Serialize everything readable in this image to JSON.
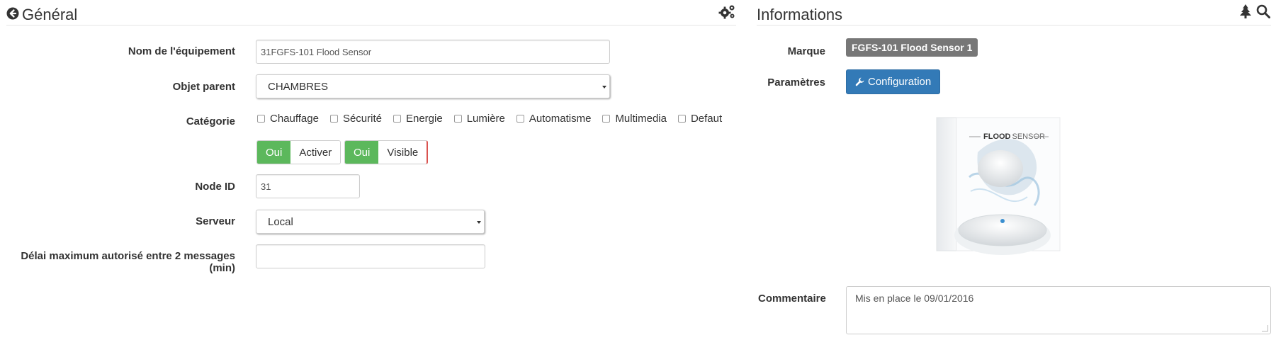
{
  "general_panel": {
    "title": "Général",
    "fields": {
      "name_label": "Nom de l'équipement",
      "name_value": "31FGFS-101 Flood Sensor",
      "parent_label": "Objet parent",
      "parent_value": "CHAMBRES",
      "category_label": "Catégorie",
      "categories": [
        "Chauffage",
        "Sécurité",
        "Energie",
        "Lumière",
        "Automatisme",
        "Multimedia",
        "Defaut"
      ],
      "toggle_activer": {
        "on_label": "Oui",
        "off_label": "Activer"
      },
      "toggle_visible": {
        "on_label": "Oui",
        "off_label": "Visible"
      },
      "node_label": "Node ID",
      "node_value": "31",
      "server_label": "Serveur",
      "server_value": "Local",
      "delay_label": "Délai maximum autorisé entre 2 messages (min)",
      "delay_value": ""
    }
  },
  "info_panel": {
    "title": "Informations",
    "brand_label": "Marque",
    "brand_value": "FGFS-101 Flood Sensor 1",
    "params_label": "Paramètres",
    "config_button": "Configuration",
    "comment_label": "Commentaire",
    "comment_value": "Mis en place le 09/01/2016",
    "product_image": {
      "brand_text": "FLOOD",
      "model_text": "SENSOR"
    }
  },
  "icons": {
    "back": "arrow-circle-left-icon",
    "gears": "cogs-icon",
    "tree": "tree-icon",
    "search": "search-icon",
    "wrench": "wrench-icon"
  },
  "colors": {
    "success": "#5cb85c",
    "primary": "#337ab7",
    "badge": "#777777",
    "text": "#333333"
  }
}
